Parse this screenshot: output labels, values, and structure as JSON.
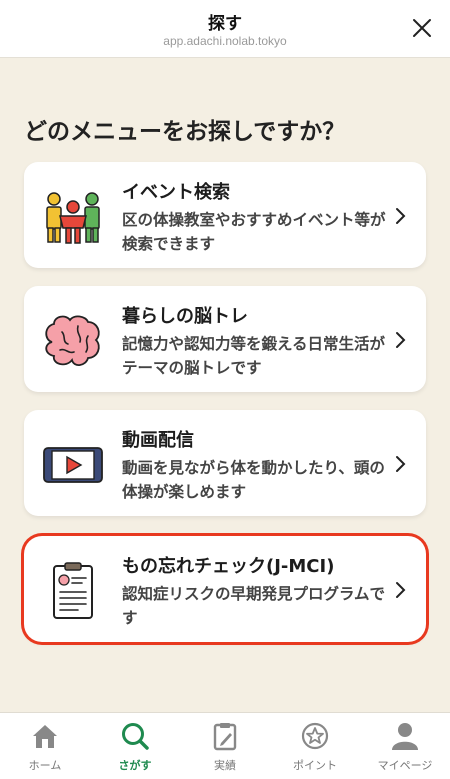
{
  "header": {
    "title": "探す",
    "url": "app.adachi.nolab.tokyo"
  },
  "heading": "どのメニューをお探しですか？",
  "cards": [
    {
      "title": "イベント検索",
      "description": "区の体操教室やおすすめイベント等が検索できます",
      "icon": "people-icon"
    },
    {
      "title": "暮らしの脳トレ",
      "description": "記憶力や認知力等を鍛える日常生活がテーマの脳トレです",
      "icon": "brain-icon"
    },
    {
      "title": "動画配信",
      "description": "動画を見ながら体を動かしたり、頭の体操が楽しめます",
      "icon": "video-play-icon"
    },
    {
      "title": "もの忘れチェック(J-MCI)",
      "description": "認知症リスクの早期発見プログラムです",
      "icon": "clipboard-icon"
    }
  ],
  "tabs": [
    {
      "label": "ホーム",
      "icon": "home-icon"
    },
    {
      "label": "さがす",
      "icon": "search-icon",
      "active": true
    },
    {
      "label": "実績",
      "icon": "clipboard-pencil-icon"
    },
    {
      "label": "ポイント",
      "icon": "star-icon"
    },
    {
      "label": "マイページ",
      "icon": "person-icon"
    }
  ],
  "colors": {
    "background": "#f4efe3",
    "accent_green": "#1f8a4f",
    "highlight_red": "#e8391f"
  }
}
